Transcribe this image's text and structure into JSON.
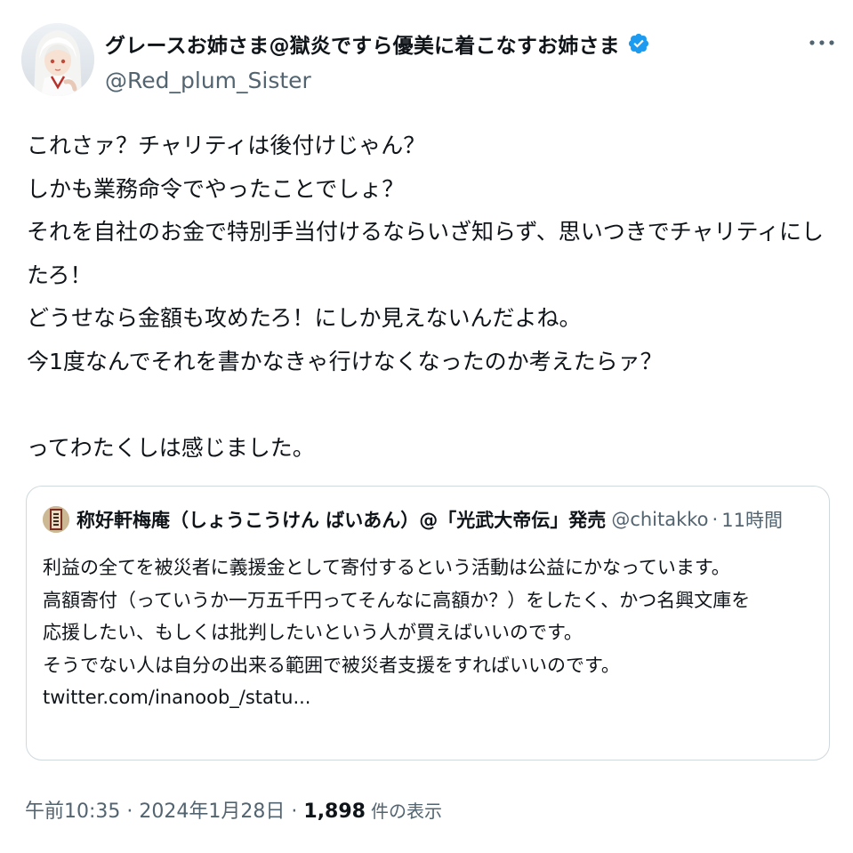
{
  "author": {
    "display_name": "グレースお姉さま@獄炎ですら優美に着こなすお姉さま",
    "handle": "@Red_plum_Sister",
    "verified": true
  },
  "icons": {
    "more": "more-horizontal-icon",
    "verified": "verified-badge-icon"
  },
  "tweet": {
    "lines": [
      "これさァ？チャリティは後付けじゃん？",
      "しかも業務命令でやったことでしょ？",
      "それを自社のお金で特別手当付けるならいざ知らず、思いつきでチャリティにし",
      "たろ！",
      "どうせなら金額も攻めたろ！にしか見えないんだよね。",
      "今1度なんでそれを書かなきゃ行けなくなったのか考えたらァ？",
      "",
      "ってわたくしは感じました。"
    ]
  },
  "quote": {
    "name": "称好軒梅庵（しょうこうけん ばいあん）@「光武大帝伝」発売",
    "handle": "@chitakko",
    "separator": "·",
    "time": "11時間",
    "lines": [
      "利益の全てを被災者に義援金として寄付するという活動は公益にかなっています。",
      "高額寄付（っていうか一万五千円ってそんなに高額か？）をしたく、かつ名興文庫を",
      "応援したい、もしくは批判したいという人が買えばいいのです。",
      "そうでない人は自分の出来る範囲で被災者支援をすればいいのです。",
      "twitter.com/inanoob_/statu..."
    ]
  },
  "meta": {
    "time": "午前10:35",
    "separator1": "·",
    "date": "2024年1月28日",
    "separator2": "·",
    "views": "1,898",
    "views_suffix": "件の表示"
  },
  "colors": {
    "text": "#0f1419",
    "secondary": "#536471",
    "verified": "#1d9bf0",
    "border": "#cfd9de"
  }
}
